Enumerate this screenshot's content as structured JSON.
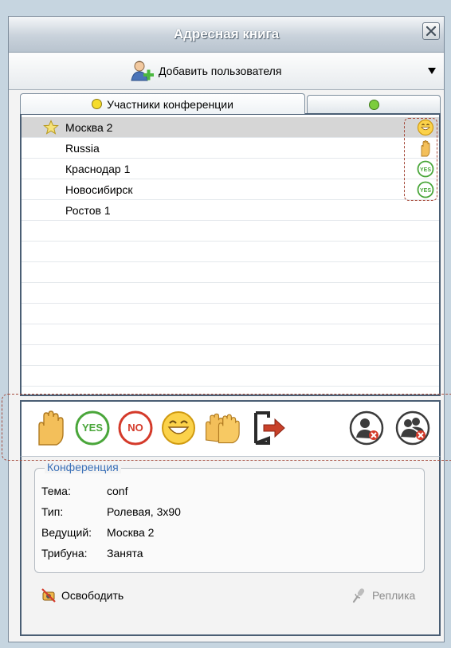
{
  "window": {
    "title": "Адресная книга"
  },
  "toolbar": {
    "add_user_label": "Добавить пользователя"
  },
  "tabs": [
    {
      "label": "Участники конференции",
      "dot_color": "#f5dc2a"
    },
    {
      "label": "",
      "dot_color": "#7ccc3c"
    }
  ],
  "participants": [
    {
      "name": "Москва 2",
      "selected": true,
      "starred": true,
      "status": "smile-icon"
    },
    {
      "name": "Russia",
      "selected": false,
      "starred": false,
      "status": "raised-hand-icon"
    },
    {
      "name": "Краснодар 1",
      "selected": false,
      "starred": false,
      "status": "yes-icon"
    },
    {
      "name": "Новосибирск",
      "selected": false,
      "starred": false,
      "status": "yes-icon"
    },
    {
      "name": "Ростов 1",
      "selected": false,
      "starred": false,
      "status": ""
    }
  ],
  "actions": {
    "raise_hand": "raise-hand-icon",
    "yes_label": "YES",
    "no_label": "NO",
    "smile": "smile-icon",
    "applause": "applause-icon",
    "exit": "exit-icon",
    "remove_user": "remove-user-icon",
    "remove_all": "remove-all-users-icon"
  },
  "conference": {
    "legend": "Конференция",
    "topic_label": "Тема:",
    "topic_value": "conf",
    "type_label": "Тип:",
    "type_value": "Ролевая, 3x90",
    "host_label": "Ведущий:",
    "host_value": "Москва 2",
    "tribune_label": "Трибуна:",
    "tribune_value": "Занята"
  },
  "buttons": {
    "free_label": "Освободить",
    "reply_label": "Реплика"
  },
  "colors": {
    "accent": "#3a70b8",
    "yes_green": "#4aa63a",
    "no_red": "#d43a2a",
    "hand": "#f0b84a",
    "dashed_highlight": "#a54b3c"
  }
}
